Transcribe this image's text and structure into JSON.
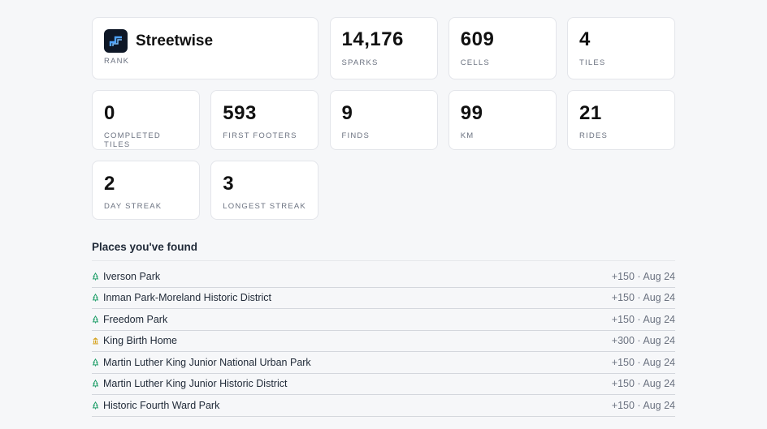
{
  "rank": {
    "name": "Streetwise",
    "label": "RANK",
    "icon": "streetwise-badge-icon"
  },
  "stats_row1": [
    {
      "value": "14,176",
      "label": "SPARKS"
    },
    {
      "value": "609",
      "label": "CELLS"
    },
    {
      "value": "4",
      "label": "TILES"
    }
  ],
  "stats_row2": [
    {
      "value": "0",
      "label": "COMPLETED TILES"
    },
    {
      "value": "593",
      "label": "FIRST FOOTERS"
    },
    {
      "value": "9",
      "label": "FINDS"
    },
    {
      "value": "99",
      "label": "KM"
    },
    {
      "value": "21",
      "label": "RIDES"
    }
  ],
  "stats_row3": [
    {
      "value": "2",
      "label": "DAY STREAK"
    },
    {
      "value": "3",
      "label": "LONGEST STREAK"
    }
  ],
  "places": {
    "title": "Places you've found",
    "items": [
      {
        "name": "Iverson Park",
        "meta": "+150 · Aug 24",
        "icon": "tree-icon"
      },
      {
        "name": "Inman Park-Moreland Historic District",
        "meta": "+150 · Aug 24",
        "icon": "tree-icon"
      },
      {
        "name": "Freedom Park",
        "meta": "+150 · Aug 24",
        "icon": "tree-icon"
      },
      {
        "name": "King Birth Home",
        "meta": "+300 · Aug 24",
        "icon": "landmark-icon"
      },
      {
        "name": "Martin Luther King Junior National Urban Park",
        "meta": "+150 · Aug 24",
        "icon": "tree-icon"
      },
      {
        "name": "Martin Luther King Junior Historic District",
        "meta": "+150 · Aug 24",
        "icon": "tree-icon"
      },
      {
        "name": "Historic Fourth Ward Park",
        "meta": "+150 · Aug 24",
        "icon": "tree-icon"
      }
    ]
  },
  "colors": {
    "tree": "#22a06b",
    "landmark": "#d4a017",
    "logo_bg": "#0e1726",
    "logo_fg": "#4fa3ff"
  }
}
